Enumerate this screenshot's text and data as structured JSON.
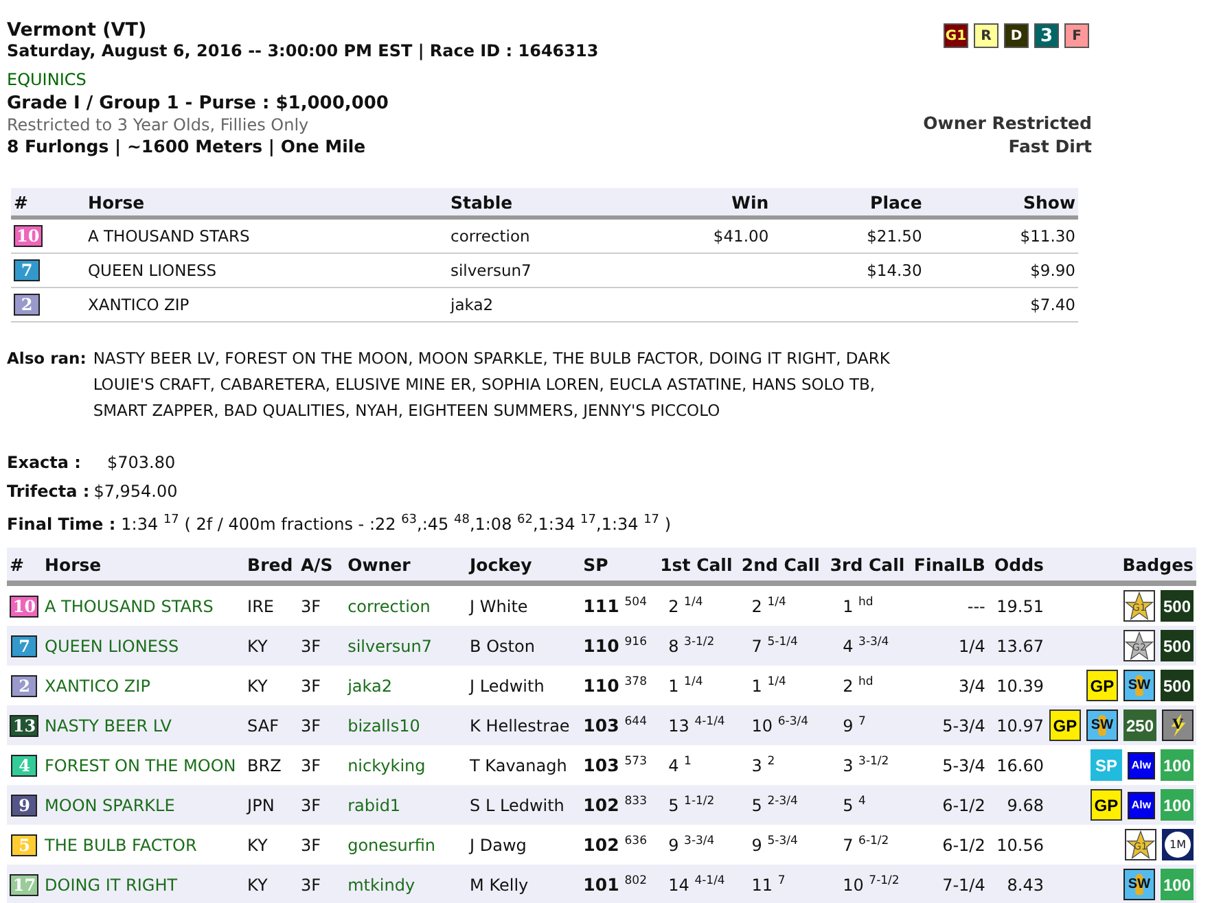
{
  "race": {
    "track": "Vermont (VT)",
    "datetime": "Saturday, August 6, 2016 -- 3:00:00 PM EST | Race ID : 1646313",
    "organizer": "EQUINICS",
    "grade": "Grade I / Group 1 - Purse : $1,000,000",
    "restriction": "Restricted to 3 Year Olds, Fillies Only",
    "distance": "8 Furlongs | ~1600 Meters | One Mile",
    "owner_restriction": "Owner Restricted",
    "surface": "Fast Dirt",
    "tags": [
      {
        "label": "G1",
        "color": "#800000"
      },
      {
        "label": "R",
        "color": "#ffff99"
      },
      {
        "label": "D",
        "color": "#333300"
      },
      {
        "label": "3",
        "color": "#006666"
      },
      {
        "label": "F",
        "color": "#ff9999"
      }
    ]
  },
  "results": {
    "columns": [
      "#",
      "Horse",
      "Stable",
      "Win",
      "Place",
      "Show"
    ],
    "rows": [
      {
        "post": "10",
        "color": "#ee66bb",
        "horse": "A THOUSAND STARS",
        "stable": "correction",
        "win": "$41.00",
        "place": "$21.50",
        "show": "$11.30"
      },
      {
        "post": "7",
        "color": "#3399cc",
        "horse": "QUEEN LIONESS",
        "stable": "silversun7",
        "place": "$14.30",
        "show": "$9.90"
      },
      {
        "post": "2",
        "color": "#9999cc",
        "horse": "XANTICO ZIP",
        "stable": "jaka2",
        "show": "$7.40"
      }
    ]
  },
  "also_ran": {
    "label": "Also ran:",
    "text": "NASTY BEER LV, FOREST ON THE MOON, MOON SPARKLE, THE BULB FACTOR, DOING IT RIGHT, DARK LOUIE'S CRAFT, CABARETERA, ELUSIVE MINE ER, SOPHIA LOREN, EUCLA ASTATINE, HANS SOLO TB, SMART ZAPPER, BAD QUALITIES, NYAH, EIGHTEEN SUMMERS, JENNY'S PICCOLO"
  },
  "payouts": [
    {
      "label": "Exacta :",
      "value": "$703.80"
    },
    {
      "label": "Trifecta :",
      "value": "$7,954.00"
    }
  ],
  "final_time": {
    "label": "Final Time :",
    "value": "1:34 $^{17}$  ( 2f / 400m fractions - :22 $^{63}$,:45 $^{48}$,1:08 $^{62}$,1:34 $^{17}$,1:34 $^{17}$ )"
  },
  "field": {
    "columns": [
      "#",
      "Horse",
      "Bred",
      "A/S",
      "Owner",
      "Jockey",
      "SP",
      "1st Call",
      "2nd Call",
      "3rd Call",
      "FinalLB",
      "Odds",
      "Badges"
    ],
    "rows": [
      {
        "post": "10",
        "color": "#ee66bb",
        "horse": "A THOUSAND STARS",
        "bred": "IRE",
        "as": "3F",
        "owner": "correction",
        "jockey": "J White",
        "sp": "**111** $^{504}$",
        "call1": "2 $^{1/4}$",
        "call2": "2 $^{1/4}$",
        "call3": "1 $^{hd}$",
        "final_lb": "---",
        "odds": "19.51",
        "badges": [
          {
            "kind": "star",
            "label": "G1",
            "color": "#e8c030"
          },
          {
            "kind": "box",
            "label": "500",
            "color": "#1a3a1a"
          }
        ]
      },
      {
        "post": "7",
        "color": "#3399cc",
        "horse": "QUEEN LIONESS",
        "bred": "KY",
        "as": "3F",
        "owner": "silversun7",
        "jockey": "B Oston",
        "sp": "**110** $^{916}$",
        "call1": "8 $^{3-1/2}$",
        "call2": "7 $^{5-1/4}$",
        "call3": "4 $^{3-3/4}$",
        "final_lb": "1/4",
        "odds": "13.67",
        "badges": [
          {
            "kind": "star",
            "label": "G2",
            "color": "#b8b8b8"
          },
          {
            "kind": "box",
            "label": "500",
            "color": "#1a3a1a"
          }
        ]
      },
      {
        "post": "2",
        "color": "#9999cc",
        "horse": "XANTICO ZIP",
        "bred": "KY",
        "as": "3F",
        "owner": "jaka2",
        "jockey": "J Ledwith",
        "sp": "**110** $^{378}$",
        "call1": "1 $^{1/4}$",
        "call2": "1 $^{1/4}$",
        "call3": "2 $^{hd}$",
        "final_lb": "3/4",
        "odds": "10.39",
        "badges": [
          {
            "kind": "box",
            "label": "GP",
            "color": "#ffee00"
          },
          {
            "kind": "figure",
            "label": "SW",
            "color": "#55bbee"
          },
          {
            "kind": "box",
            "label": "500",
            "color": "#1a3a1a"
          }
        ]
      },
      {
        "post": "13",
        "color": "#225533",
        "horse": "NASTY BEER LV",
        "bred": "SAF",
        "as": "3F",
        "owner": "bizalls10",
        "jockey": "K Hellestrae",
        "sp": "**103** $^{644}$",
        "call1": "13 $^{4-1/4}$",
        "call2": "10 $^{6-3/4}$",
        "call3": "9 $^{7}$",
        "final_lb": "5-3/4",
        "odds": "10.97",
        "badges": [
          {
            "kind": "box",
            "label": "GP",
            "color": "#ffee00"
          },
          {
            "kind": "figure",
            "label": "SW",
            "color": "#55bbee"
          },
          {
            "kind": "box",
            "label": "250",
            "color": "#336633"
          },
          {
            "kind": "bolt",
            "label": "V",
            "color": "#888888"
          }
        ]
      },
      {
        "post": "4",
        "color": "#33cc99",
        "horse": "FOREST ON THE MOON",
        "bred": "BRZ",
        "as": "3F",
        "owner": "nickyking",
        "jockey": "T Kavanagh",
        "sp": "**103** $^{573}$",
        "call1": "4 $^{1}$",
        "call2": "3 $^{2}$",
        "call3": "3 $^{3-1/2}$",
        "final_lb": "5-3/4",
        "odds": "16.60",
        "badges": [
          {
            "kind": "box",
            "label": "SP",
            "color": "#22bbdd"
          },
          {
            "kind": "small",
            "label": "Alw",
            "color": "#0000ee"
          },
          {
            "kind": "box",
            "label": "100",
            "color": "#33aa55"
          }
        ]
      },
      {
        "post": "9",
        "color": "#555588",
        "horse": "MOON SPARKLE",
        "bred": "JPN",
        "as": "3F",
        "owner": "rabid1",
        "jockey": "S L Ledwith",
        "sp": "**102** $^{833}$",
        "call1": "5 $^{1-1/2}$",
        "call2": "5 $^{2-3/4}$",
        "call3": "5 $^{4}$",
        "final_lb": "6-1/2",
        "odds": "9.68",
        "badges": [
          {
            "kind": "box",
            "label": "GP",
            "color": "#ffee00"
          },
          {
            "kind": "small",
            "label": "Alw",
            "color": "#0000ee"
          },
          {
            "kind": "box",
            "label": "100",
            "color": "#33aa55"
          }
        ]
      },
      {
        "post": "5",
        "color": "#ffcc33",
        "horse": "THE BULB FACTOR",
        "bred": "KY",
        "as": "3F",
        "owner": "gonesurfin",
        "jockey": "J Dawg",
        "sp": "**102** $^{636}$",
        "call1": "9 $^{3-3/4}$",
        "call2": "9 $^{5-3/4}$",
        "call3": "7 $^{6-1/2}$",
        "final_lb": "6-1/2",
        "odds": "10.56",
        "badges": [
          {
            "kind": "star",
            "label": "G1",
            "color": "#e8c030"
          },
          {
            "kind": "circle",
            "label": "1M",
            "color": "#112266"
          }
        ]
      },
      {
        "post": "17",
        "color": "#99cc99",
        "horse": "DOING IT RIGHT",
        "bred": "KY",
        "as": "3F",
        "owner": "mtkindy",
        "jockey": "M Kelly",
        "sp": "**101** $^{802}$",
        "call1": "14 $^{4-1/4}$",
        "call2": "11 $^{7}$",
        "call3": "10 $^{7-1/2}$",
        "final_lb": "7-1/4",
        "odds": "8.43",
        "badges": [
          {
            "kind": "figure",
            "label": "SW",
            "color": "#55bbee"
          },
          {
            "kind": "box",
            "label": "100",
            "color": "#33aa55"
          }
        ]
      }
    ]
  }
}
